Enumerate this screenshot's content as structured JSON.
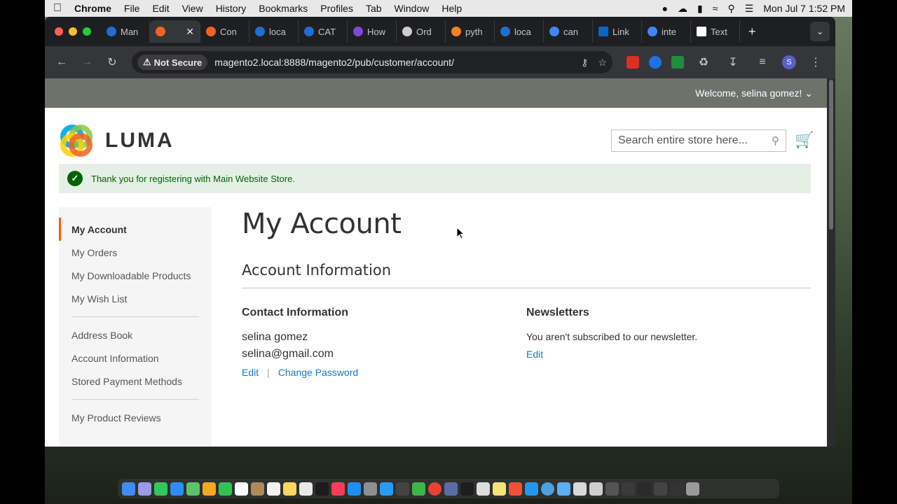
{
  "menubar": {
    "app": "Chrome",
    "items": [
      "File",
      "Edit",
      "View",
      "History",
      "Bookmarks",
      "Profiles",
      "Tab",
      "Window",
      "Help"
    ],
    "clock": "Mon Jul 7  1:52 PM"
  },
  "browser": {
    "tabs": [
      {
        "label": "Man",
        "color": "#1f6fd1"
      },
      {
        "label": "",
        "color": "#f26322",
        "active": true
      },
      {
        "label": "Con",
        "color": "#f26322"
      },
      {
        "label": "loca",
        "color": "#1f6fd1"
      },
      {
        "label": "CAT",
        "color": "#1f6fd1"
      },
      {
        "label": "How",
        "color": "#7b4bd6"
      },
      {
        "label": "Ord",
        "color": "#cccccc"
      },
      {
        "label": "pyth",
        "color": "#f48024"
      },
      {
        "label": "loca",
        "color": "#1f6fd1"
      },
      {
        "label": "can",
        "color": "#4285f4"
      },
      {
        "label": "Link",
        "color": "#0a66c2"
      },
      {
        "label": "inte",
        "color": "#4285f4"
      },
      {
        "label": "Text",
        "color": "#ffffff"
      }
    ],
    "not_secure": "Not Secure",
    "url": "magento2.local:8888/magento2/pub/customer/account/"
  },
  "page": {
    "welcome": "Welcome, selina gomez!",
    "logo_text": "LUMA",
    "search_placeholder": "Search entire store here...",
    "success_message": "Thank you for registering with Main Website Store.",
    "sidebar": {
      "group1": [
        "My Account",
        "My Orders",
        "My Downloadable Products",
        "My Wish List"
      ],
      "group2": [
        "Address Book",
        "Account Information",
        "Stored Payment Methods"
      ],
      "group3": [
        "My Product Reviews"
      ]
    },
    "title": "My Account",
    "section_title": "Account Information",
    "contact": {
      "heading": "Contact Information",
      "name": "selina gomez",
      "email": "selina@gmail.com",
      "edit": "Edit",
      "change_password": "Change Password"
    },
    "newsletters": {
      "heading": "Newsletters",
      "text": "You aren't subscribed to our newsletter.",
      "edit": "Edit"
    }
  },
  "colors": {
    "accent": "#ff5501",
    "link": "#1979c3",
    "success_bg": "#e5efe5",
    "success_text": "#006400"
  }
}
